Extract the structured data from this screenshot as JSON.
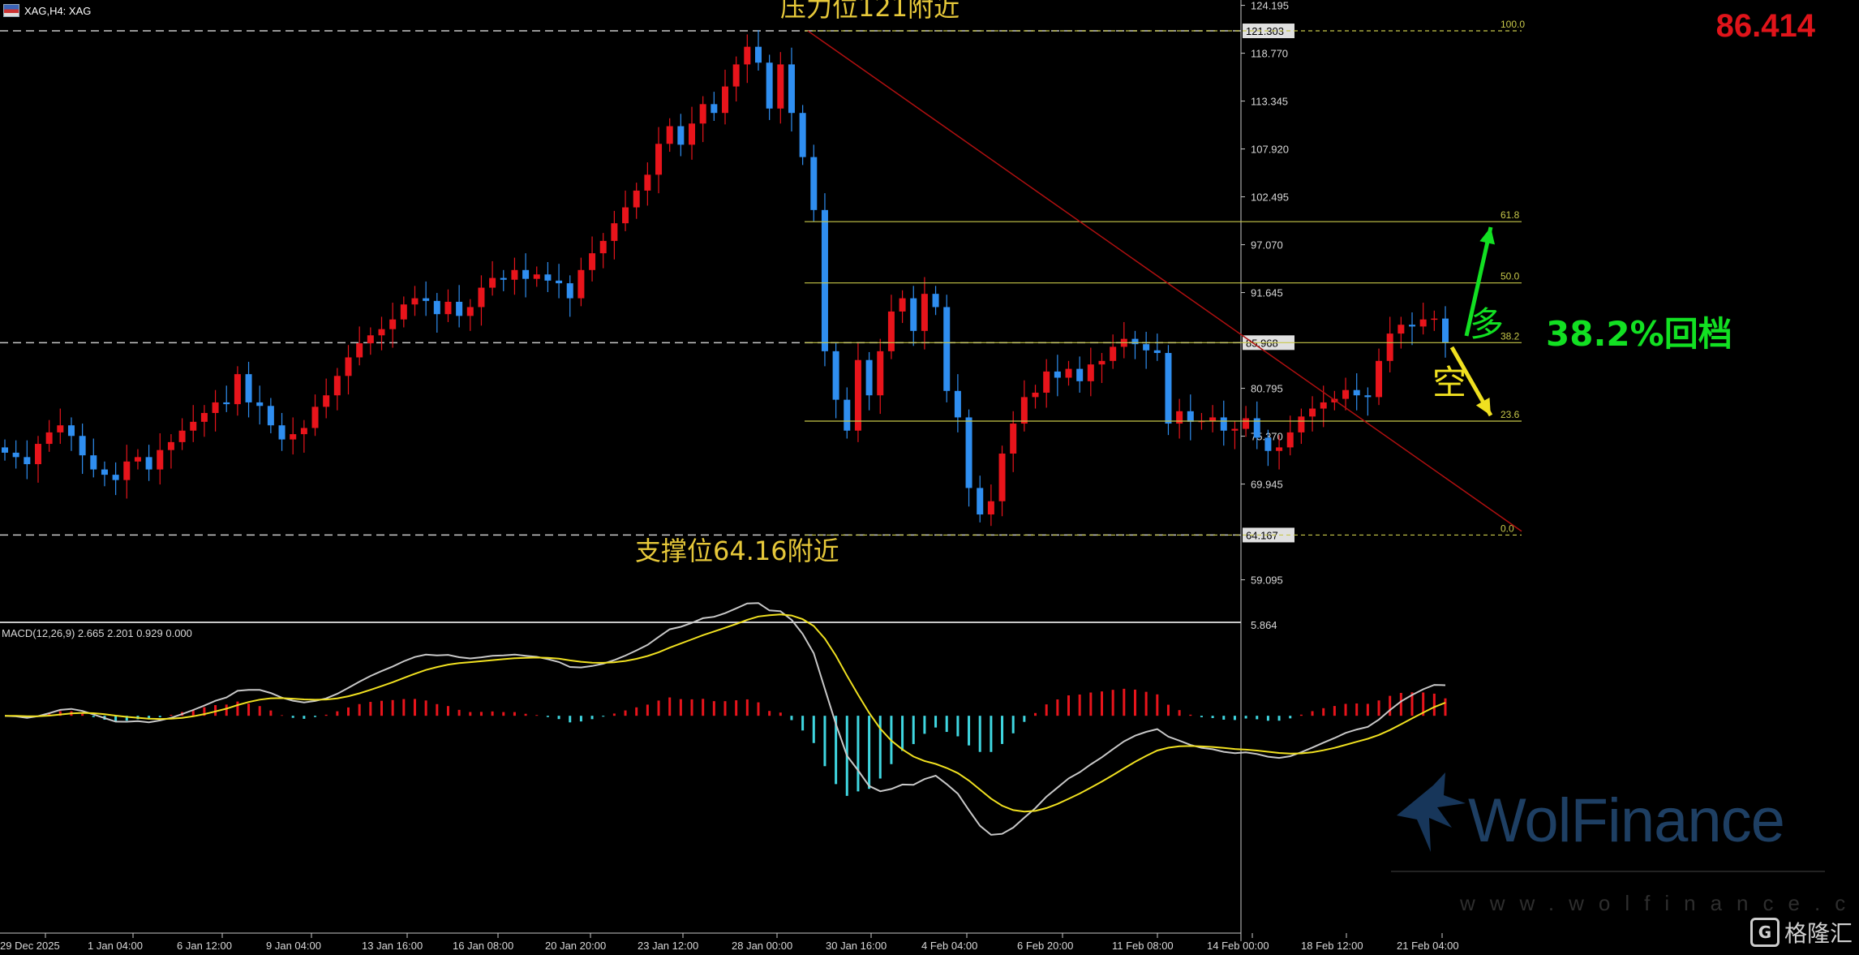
{
  "header": {
    "symbol_label": "XAG,H4: XAG"
  },
  "big_price": "86.414",
  "annotations": {
    "resistance": "压力位121附近",
    "support": "支撑位64.16附近",
    "retrace": "38.2%回档",
    "long": "多",
    "short": "空"
  },
  "watermark": {
    "brand": "WolFinance",
    "url": "www.wolfinance.com"
  },
  "corner_badge": {
    "label": "格隆汇"
  },
  "colors": {
    "bull": "#e8141b",
    "bear": "#2f8ef0",
    "fib": "#c8c84a",
    "trend": "#b01010",
    "macd_pos": "#e8141b",
    "macd_neg": "#3fd6e0",
    "macd_line": "#c8c8c8",
    "signal_line": "#f0e020",
    "green_arrow": "#12e022",
    "yellow_arrow": "#f0e020",
    "price_big": "#e0141a"
  },
  "chart_data": [
    {
      "type": "candlestick",
      "title": "XAG,H4: XAG",
      "y_ticks": [
        "124.195",
        "118.770",
        "113.345",
        "107.920",
        "102.495",
        "97.070",
        "91.645",
        "80.795",
        "75.370",
        "69.945",
        "59.095"
      ],
      "ylim": [
        54.0,
        124.8
      ],
      "x_ticks": [
        "29 Dec 2025",
        "1 Jan 04:00",
        "6 Jan 12:00",
        "9 Jan 04:00",
        "13 Jan 16:00",
        "16 Jan 08:00",
        "20 Jan 20:00",
        "23 Jan 12:00",
        "28 Jan 00:00",
        "30 Jan 16:00",
        "4 Feb 04:00",
        "6 Feb 20:00",
        "11 Feb 08:00",
        "14 Feb 00:00",
        "18 Feb 12:00",
        "21 Feb 04:00"
      ],
      "price_labels": {
        "high_line": "121.303",
        "current": "85.968",
        "low_line": "64.167"
      },
      "close_series": [
        73.5,
        73.0,
        72.2,
        74.5,
        75.8,
        76.6,
        75.4,
        73.2,
        71.6,
        71.0,
        70.4,
        72.5,
        73.0,
        71.6,
        73.8,
        74.7,
        76.0,
        77.0,
        78.0,
        79.2,
        79.0,
        82.4,
        79.2,
        78.8,
        76.6,
        75.0,
        75.6,
        76.3,
        78.7,
        80.0,
        82.2,
        84.3,
        85.9,
        86.8,
        87.5,
        88.6,
        90.3,
        91.0,
        90.7,
        89.2,
        90.6,
        89.0,
        90.0,
        92.2,
        93.3,
        93.1,
        94.2,
        93.2,
        93.7,
        93.0,
        92.7,
        91.0,
        94.2,
        96.1,
        97.5,
        99.5,
        101.3,
        103.2,
        105.0,
        108.5,
        110.5,
        108.4,
        110.8,
        113.0,
        112.0,
        115.0,
        117.5,
        119.5,
        117.7,
        112.5,
        117.5,
        112.0,
        107.0,
        101.0,
        85.0,
        79.5,
        76.0,
        84.0,
        80.0,
        85.0,
        89.5,
        91.0,
        87.3,
        91.5,
        90.0,
        80.5,
        77.5,
        69.5,
        66.5,
        68.0,
        73.4,
        76.8,
        79.8,
        80.3,
        82.7,
        82.0,
        83.0,
        81.6,
        83.5,
        83.9,
        85.5,
        86.4,
        85.8,
        85.1,
        84.8,
        76.8,
        78.2,
        77.0,
        77.1,
        77.5,
        76.0,
        76.2,
        77.4,
        75.2,
        73.7,
        74.1,
        75.8,
        77.6,
        78.5,
        79.2,
        79.6,
        80.6,
        80.0,
        79.8,
        83.9,
        87.0,
        88.0,
        87.8,
        88.6,
        88.7,
        85.97
      ],
      "fib_levels": [
        {
          "label": "100.0",
          "price": 121.303
        },
        {
          "label": "61.8",
          "price": 99.68
        },
        {
          "label": "50.0",
          "price": 92.74
        },
        {
          "label": "38.2",
          "price": 85.97
        },
        {
          "label": "23.6",
          "price": 77.08
        },
        {
          "label": "0.0",
          "price": 64.167
        }
      ]
    },
    {
      "type": "histogram+line",
      "title": "MACD(12,26,9) 2.665 2.201 0.929 0.000",
      "y_ticks": [
        "5.864"
      ],
      "macd": 2.665,
      "signal": 2.201,
      "histogram": 0.929,
      "level": 0.0,
      "ylim": [
        -14.0,
        5.864
      ]
    }
  ]
}
